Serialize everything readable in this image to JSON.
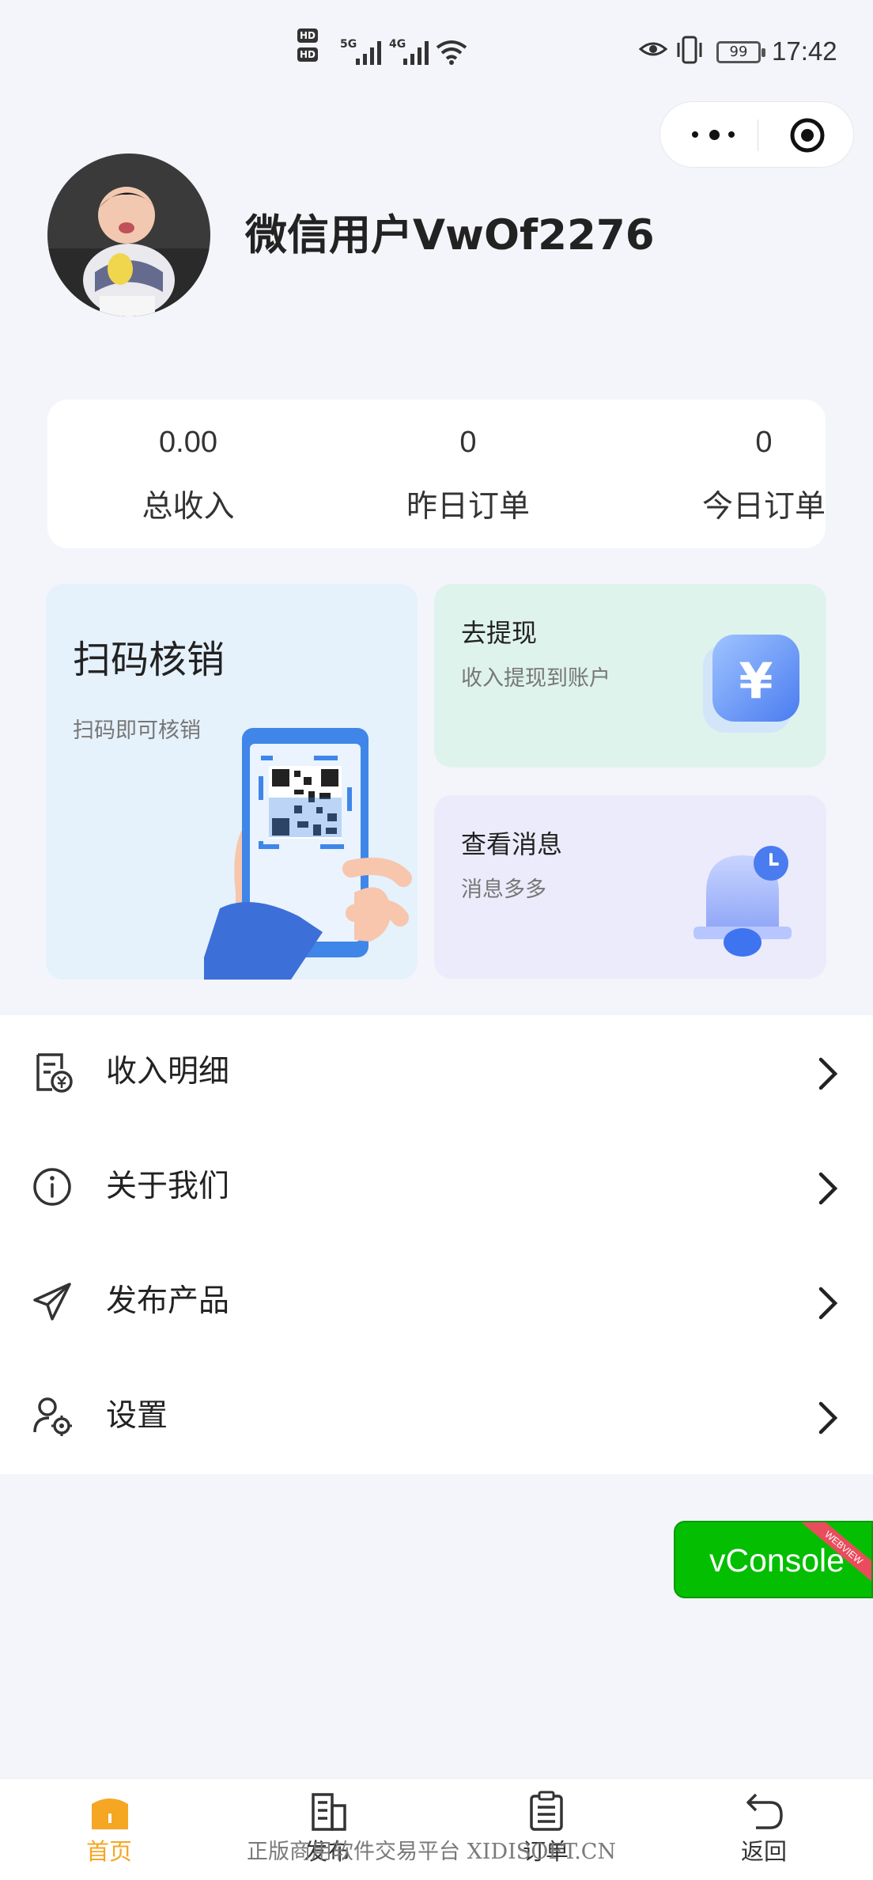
{
  "status_bar": {
    "hd1": "HD",
    "hd2": "HD",
    "net1": "5G",
    "net2": "4G",
    "battery": "99",
    "time": "17:42"
  },
  "profile": {
    "username": "微信用户VwOf2276"
  },
  "stats": [
    {
      "value": "0.00",
      "label": "总收入"
    },
    {
      "value": "0",
      "label": "昨日订单"
    },
    {
      "value": "0",
      "label": "今日订单"
    }
  ],
  "cards": {
    "scan": {
      "title": "扫码核销",
      "subtitle": "扫码即可核销"
    },
    "withdraw": {
      "title": "去提现",
      "subtitle": "收入提现到账户",
      "icon_glyph": "¥"
    },
    "messages": {
      "title": "查看消息",
      "subtitle": "消息多多"
    }
  },
  "menu": [
    {
      "label": "收入明细",
      "icon": "income-detail-icon"
    },
    {
      "label": "关于我们",
      "icon": "info-icon"
    },
    {
      "label": "发布产品",
      "icon": "paper-plane-icon"
    },
    {
      "label": "设置",
      "icon": "user-settings-icon"
    }
  ],
  "vconsole": {
    "label": "vConsole",
    "ribbon": "WEBVIEW"
  },
  "tabbar": [
    {
      "label": "首页",
      "icon": "home-icon",
      "active": true
    },
    {
      "label": "发布",
      "icon": "building-icon",
      "active": false
    },
    {
      "label": "订单",
      "icon": "clipboard-icon",
      "active": false
    },
    {
      "label": "返回",
      "icon": "return-icon",
      "active": false
    }
  ],
  "watermark": "正版商用软件交易平台 XIDISOFT.CN",
  "colors": {
    "accent": "#f5a623",
    "background": "#f4f5fa",
    "scan_card": "#e5f1fb",
    "withdraw_card": "#def3ec",
    "message_card": "#ebebfb",
    "vconsole": "#04be02"
  }
}
